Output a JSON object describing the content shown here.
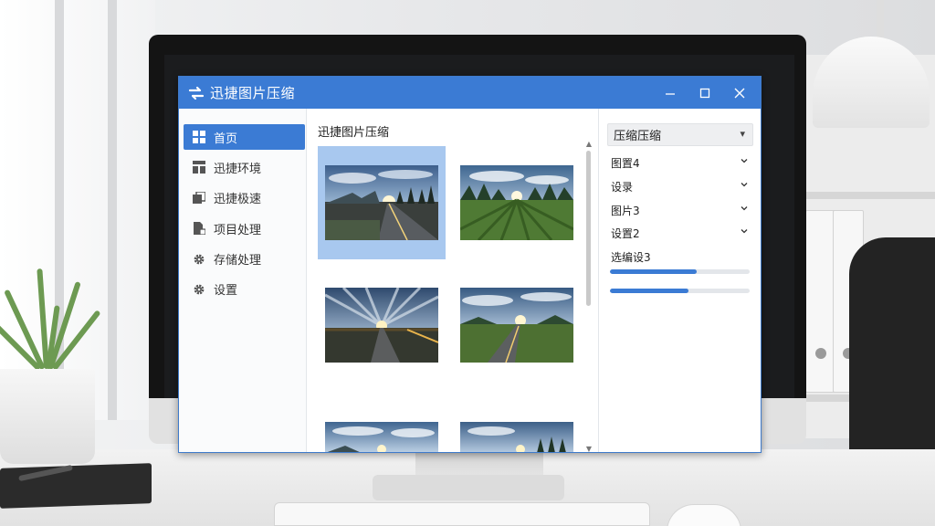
{
  "app": {
    "title": "迅捷图片压缩"
  },
  "sidebar": {
    "items": [
      {
        "label": "首页",
        "icon": "grid-icon",
        "active": true
      },
      {
        "label": "迅捷环境",
        "icon": "layout-icon",
        "active": false
      },
      {
        "label": "迅捷极速",
        "icon": "image-stack-icon",
        "active": false
      },
      {
        "label": "项目处理",
        "icon": "file-lock-icon",
        "active": false
      },
      {
        "label": "存储处理",
        "icon": "gear-icon",
        "active": false
      },
      {
        "label": "设置",
        "icon": "gear-icon",
        "active": false
      }
    ]
  },
  "main": {
    "title": "迅捷图片压缩",
    "thumbnails": [
      {
        "scene": "road-sunset",
        "selected": true
      },
      {
        "scene": "field-rows",
        "selected": false
      },
      {
        "scene": "road-sunburst",
        "selected": false
      },
      {
        "scene": "road-field",
        "selected": false
      },
      {
        "scene": "road-sunset",
        "selected": false
      },
      {
        "scene": "road-forest",
        "selected": false
      }
    ]
  },
  "panel": {
    "select_label": "压缩压缩",
    "rows": [
      {
        "label": "图置4"
      },
      {
        "label": "设录"
      },
      {
        "label": "图片3"
      },
      {
        "label": "设置2"
      }
    ],
    "progress_label": "选编设3",
    "progress": [
      0.62,
      0.56
    ]
  },
  "colors": {
    "accent": "#3b7bd4",
    "selected_thumb": "#a8c8ef"
  }
}
